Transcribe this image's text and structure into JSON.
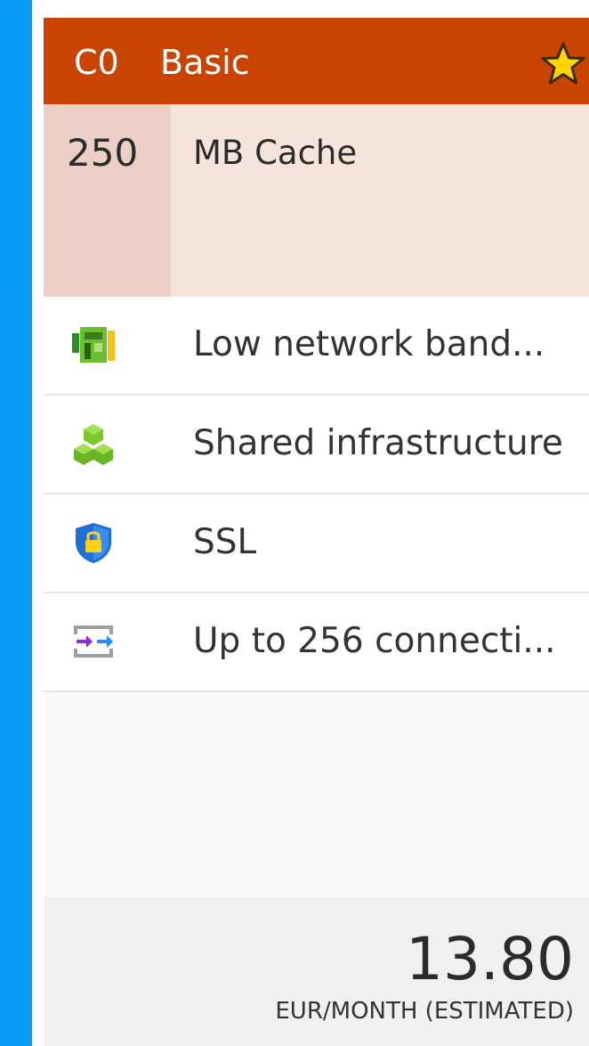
{
  "tier": {
    "code": "C0",
    "name": "Basic",
    "header_color": "#c84400",
    "star_icon": "star-icon"
  },
  "cache": {
    "size": "250",
    "unit_label": "MB Cache"
  },
  "features": [
    {
      "icon": "network-bandwidth-icon",
      "label": "Low network band..."
    },
    {
      "icon": "shared-infrastructure-icon",
      "label": "Shared infrastructure"
    },
    {
      "icon": "ssl-shield-icon",
      "label": "SSL"
    },
    {
      "icon": "connections-icon",
      "label": "Up to 256 connecti..."
    }
  ],
  "pricing": {
    "amount": "13.80",
    "label": "EUR/MONTH (ESTIMATED)"
  }
}
